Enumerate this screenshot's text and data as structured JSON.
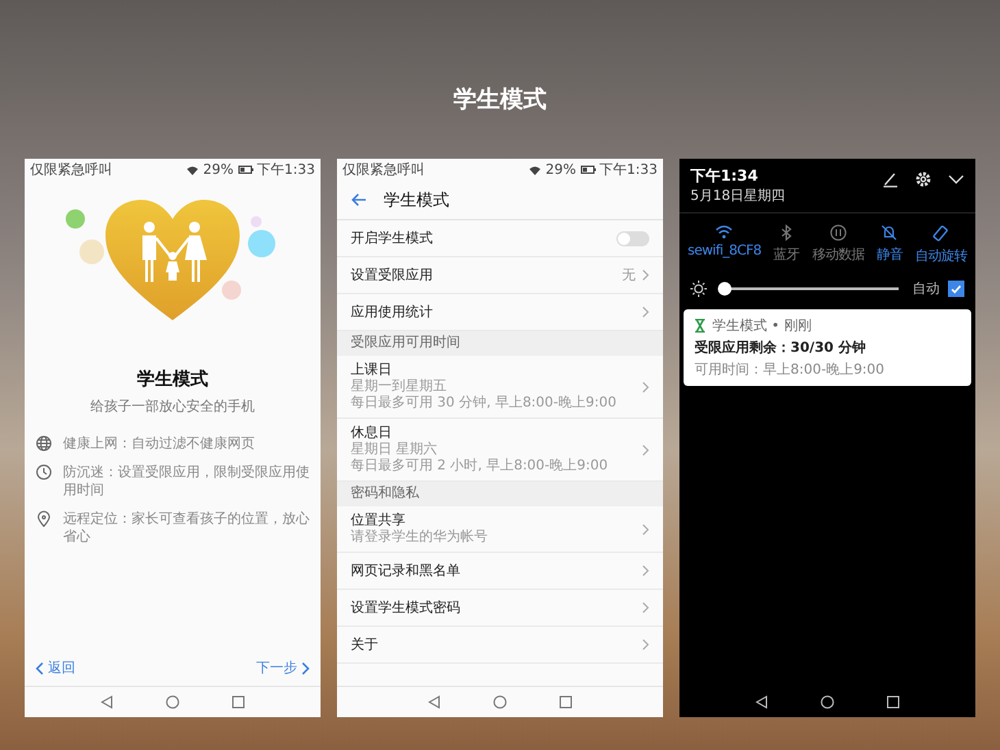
{
  "title": "学生模式",
  "intro_screen": {
    "status_bar": {
      "carrier": "仅限紧急呼叫",
      "battery": "29%",
      "time": "下午1:33"
    },
    "title": "学生模式",
    "subtitle": "给孩子一部放心安全的手机",
    "features": [
      {
        "kind": "globe",
        "text": "健康上网：自动过滤不健康网页"
      },
      {
        "kind": "clock",
        "text": "防沉迷：设置受限应用，限制受限应用使用时间"
      },
      {
        "kind": "pin",
        "text": "远程定位：家长可查看孩子的位置，放心省心"
      }
    ],
    "back_link": "返回",
    "next_link": "下一步"
  },
  "settings_screen": {
    "status_bar": {
      "carrier": "仅限紧急呼叫",
      "battery": "29%",
      "time": "下午1:33"
    },
    "header_title": "学生模式",
    "rows": [
      {
        "kind": "toggle",
        "label": "开启学生模式",
        "on": false
      },
      {
        "kind": "link",
        "label": "设置受限应用",
        "value": "无"
      },
      {
        "kind": "link",
        "label": "应用使用统计"
      },
      {
        "kind": "section",
        "label": "受限应用可用时间"
      },
      {
        "kind": "detail",
        "label": "上课日",
        "lines": [
          "星期一到星期五",
          "每日最多可用 30 分钟, 早上8:00-晚上9:00"
        ]
      },
      {
        "kind": "detail",
        "label": "休息日",
        "lines": [
          "星期日 星期六",
          "每日最多可用 2 小时, 早上8:00-晚上9:00"
        ]
      },
      {
        "kind": "section",
        "label": "密码和隐私"
      },
      {
        "kind": "detail",
        "label": "位置共享",
        "lines": [
          "请登录学生的华为帐号"
        ]
      },
      {
        "kind": "link",
        "label": "网页记录和黑名单"
      },
      {
        "kind": "link",
        "label": "设置学生模式密码"
      },
      {
        "kind": "link",
        "label": "关于"
      }
    ]
  },
  "notification_shade": {
    "time": "下午1:34",
    "date": "5月18日星期四",
    "tiles": [
      {
        "kind": "wifi",
        "label": "sewifi_8CF8",
        "on": true
      },
      {
        "kind": "bluetooth",
        "label": "蓝牙",
        "on": false
      },
      {
        "kind": "data",
        "label": "移动数据",
        "on": false
      },
      {
        "kind": "mute",
        "label": "静音",
        "on": true
      },
      {
        "kind": "rotate",
        "label": "自动旋转",
        "on": true
      }
    ],
    "brightness": {
      "level": 0.02
    },
    "auto_label": "自动",
    "auto_checked": true,
    "notification": {
      "app": "学生模式 • 刚刚",
      "headline": "受限应用剩余：30/30 分钟",
      "detail": "可用时间：早上8:00-晚上9:00"
    }
  }
}
